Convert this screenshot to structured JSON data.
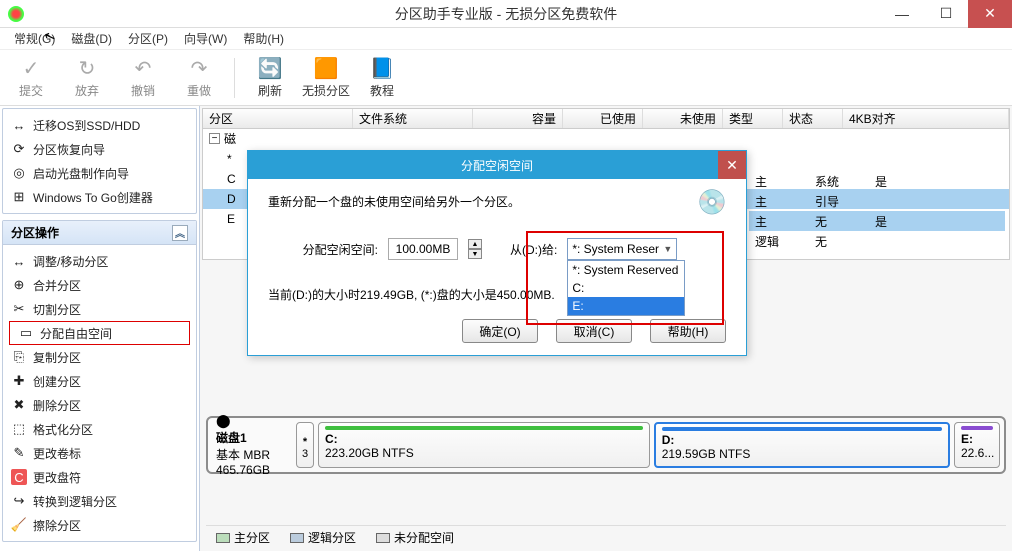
{
  "window": {
    "title": "分区助手专业版 - 无损分区免费软件"
  },
  "menu": {
    "general": "常规(G)",
    "disk": "磁盘(D)",
    "partition": "分区(P)",
    "wizard": "向导(W)",
    "help": "帮助(H)"
  },
  "toolbar": {
    "commit": "提交",
    "discard": "放弃",
    "undo": "撤销",
    "redo": "重做",
    "refresh": "刷新",
    "nondestructive": "无损分区",
    "tutorial": "教程"
  },
  "wizards": {
    "items": [
      {
        "icon": "↔",
        "label": "迁移OS到SSD/HDD"
      },
      {
        "icon": "⟳",
        "label": "分区恢复向导"
      },
      {
        "icon": "◎",
        "label": "启动光盘制作向导"
      },
      {
        "icon": "⊞",
        "label": "Windows To Go创建器"
      }
    ]
  },
  "ops": {
    "title": "分区操作",
    "items": [
      {
        "icon": "↔",
        "label": "调整/移动分区"
      },
      {
        "icon": "⊕",
        "label": "合并分区"
      },
      {
        "icon": "✂",
        "label": "切割分区"
      },
      {
        "icon": "▭",
        "label": "分配自由空间",
        "hl": true
      },
      {
        "icon": "⎘",
        "label": "复制分区"
      },
      {
        "icon": "✚",
        "label": "创建分区"
      },
      {
        "icon": "✖",
        "label": "删除分区"
      },
      {
        "icon": "⬚",
        "label": "格式化分区"
      },
      {
        "icon": "✎",
        "label": "更改卷标"
      },
      {
        "icon": "C",
        "label": "更改盘符"
      },
      {
        "icon": "↪",
        "label": "转换到逻辑分区"
      },
      {
        "icon": "🧹",
        "label": "擦除分区"
      }
    ]
  },
  "grid": {
    "cols": [
      "分区",
      "文件系统",
      "容量",
      "已使用",
      "未使用",
      "类型",
      "状态",
      "4KB对齐"
    ],
    "disk_label": "磁",
    "letters": [
      "*",
      "C",
      "D",
      "E"
    ],
    "rows": [
      {
        "type": "主",
        "status": "系统",
        "align": "是"
      },
      {
        "type": "主",
        "status": "引导",
        "align": ""
      },
      {
        "type": "主",
        "status": "无",
        "align": "是",
        "sel": true
      },
      {
        "type": "逻辑",
        "status": "无",
        "align": ""
      }
    ]
  },
  "diskmap": {
    "disk": {
      "name": "磁盘1",
      "base": "基本 MBR",
      "size": "465.76GB"
    },
    "segs": {
      "star": {
        "top": "*",
        "bottom": "3"
      },
      "c": {
        "letter": "C:",
        "size": "223.20GB NTFS"
      },
      "d": {
        "letter": "D:",
        "size": "219.59GB NTFS"
      },
      "e": {
        "letter": "E:",
        "size": "22.6..."
      }
    }
  },
  "legend": {
    "primary": "主分区",
    "logical": "逻辑分区",
    "unalloc": "未分配空间"
  },
  "dialog": {
    "title": "分配空闲空间",
    "desc": "重新分配一个盘的未使用空间给另外一个分区。",
    "field_label": "分配空闲空间:",
    "field_value": "100.00MB",
    "from_label": "从(D:)给:",
    "selected": "*: System Reser",
    "options": [
      "*: System Reserved",
      "C:",
      "E:"
    ],
    "hint": "当前(D:)的大小时219.49GB, (*:)盘的大小是450.00MB.",
    "ok": "确定(O)",
    "cancel": "取消(C)",
    "help": "帮助(H)"
  }
}
